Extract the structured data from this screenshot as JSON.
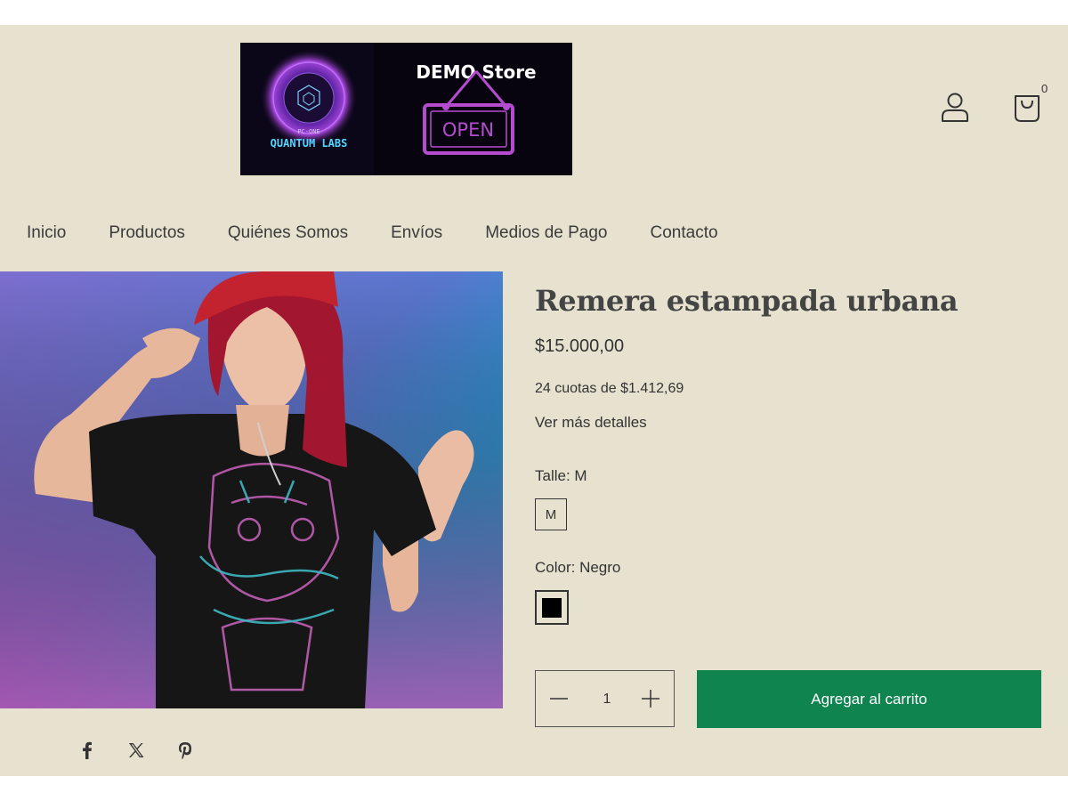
{
  "header": {
    "logo": {
      "left_text": "QUANTUM LABS",
      "left_small_text": "PC-ONE",
      "store_name": "DEMO Store",
      "sign_text": "OPEN"
    },
    "account_icon": "user-icon",
    "cart_icon": "bag-icon",
    "cart_count": "0"
  },
  "nav": {
    "items": [
      {
        "label": "Inicio"
      },
      {
        "label": "Productos"
      },
      {
        "label": "Quiénes Somos"
      },
      {
        "label": "Envíos"
      },
      {
        "label": "Medios de Pago"
      },
      {
        "label": "Contacto"
      }
    ]
  },
  "product": {
    "title": "Remera estampada urbana",
    "price": "$15.000,00",
    "installments": "24 cuotas de $1.412,69",
    "details_link": "Ver más detalles",
    "size_label": "Talle: M",
    "size_options": [
      {
        "label": "M",
        "selected": true
      }
    ],
    "color_label": "Color: Negro",
    "color_options": [
      {
        "name": "Negro",
        "hex": "#000000",
        "selected": true
      }
    ],
    "quantity": "1",
    "add_to_cart": "Agregar al carrito"
  },
  "share": {
    "icons": [
      "facebook-icon",
      "x-icon",
      "pinterest-icon"
    ]
  },
  "colors": {
    "background": "#e6e2cf",
    "primary_button": "#0f844e",
    "text": "#333333"
  }
}
